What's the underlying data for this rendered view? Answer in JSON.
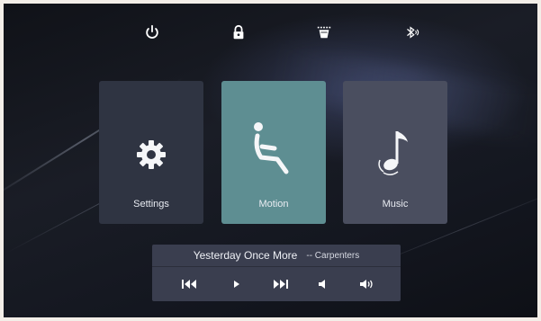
{
  "status_bar": {
    "icons": [
      "power-icon",
      "lock-icon",
      "cup-holder-icon",
      "bluetooth-icon"
    ]
  },
  "tiles": [
    {
      "label": "Settings",
      "icon": "gear-icon"
    },
    {
      "label": "Motion",
      "icon": "recline-seat-icon"
    },
    {
      "label": "Music",
      "icon": "music-note-icon"
    }
  ],
  "player": {
    "title": "Yesterday Once More",
    "artist": "-- Carpenters",
    "controls": [
      "previous-icon",
      "play-icon",
      "next-icon",
      "volume-down-icon",
      "volume-up-icon"
    ]
  },
  "colors": {
    "motion_active": "#5e8e92",
    "settings_tile": "#2f3442",
    "music_tile": "#4a4e5f",
    "player_bg": "#3a3e4f"
  }
}
